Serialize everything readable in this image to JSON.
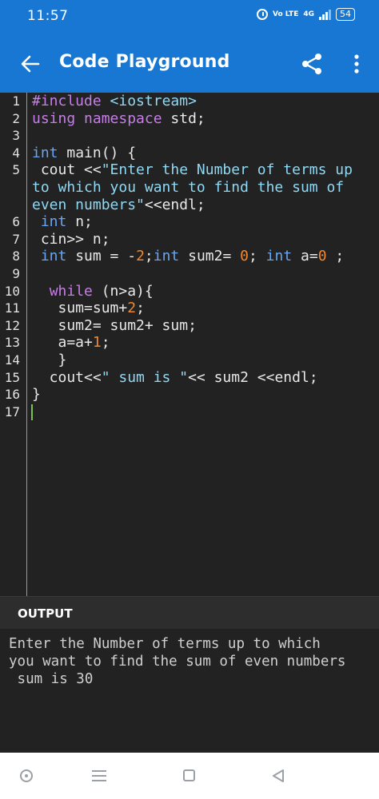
{
  "status_bar": {
    "time": "11:57",
    "net_label": "Vo LTE",
    "net_type": "4G",
    "battery": "54"
  },
  "app_bar": {
    "title": "Code Playground",
    "back_icon": "arrow-left-icon",
    "share_icon": "share-icon",
    "more_icon": "more-vert-icon"
  },
  "editor": {
    "lines": [
      {
        "n": "1",
        "text": "#include <iostream>"
      },
      {
        "n": "2",
        "text": "using namespace std;"
      },
      {
        "n": "3",
        "text": ""
      },
      {
        "n": "4",
        "text": "int main() {"
      },
      {
        "n": "5",
        "text": " cout <<\"Enter the Number of terms up to which you want to find the sum of even numbers\"<<endl;"
      },
      {
        "n": "6",
        "text": " int n;"
      },
      {
        "n": "7",
        "text": " cin>> n;"
      },
      {
        "n": "8",
        "text": " int sum = -2;int sum2= 0; int a=0 ;"
      },
      {
        "n": "9",
        "text": ""
      },
      {
        "n": "10",
        "text": "  while (n>a){"
      },
      {
        "n": "11",
        "text": "   sum=sum+2;"
      },
      {
        "n": "12",
        "text": "   sum2= sum2+ sum;"
      },
      {
        "n": "13",
        "text": "   a=a+1;"
      },
      {
        "n": "14",
        "text": "   }"
      },
      {
        "n": "15",
        "text": "  cout<<\" sum is \"<< sum2 <<endl;"
      },
      {
        "n": "16",
        "text": "}"
      },
      {
        "n": "17",
        "text": ""
      }
    ]
  },
  "output": {
    "label": "OUTPUT",
    "text": "Enter the Number of terms up to which\nyou want to find the sum of even numbers\n sum is 30"
  },
  "nav_bar": {
    "home_icon": "home-circle-icon",
    "menu_icon": "recents-menu-icon",
    "square_icon": "overview-square-icon",
    "back_icon": "nav-back-triangle-icon"
  },
  "colors": {
    "primary": "#1877d2",
    "editor_bg": "#222222",
    "keyword": "#c77de8",
    "type": "#6aa5f0",
    "number": "#f0882e",
    "string": "#8ed9f5",
    "cursor": "#7cc24a"
  }
}
